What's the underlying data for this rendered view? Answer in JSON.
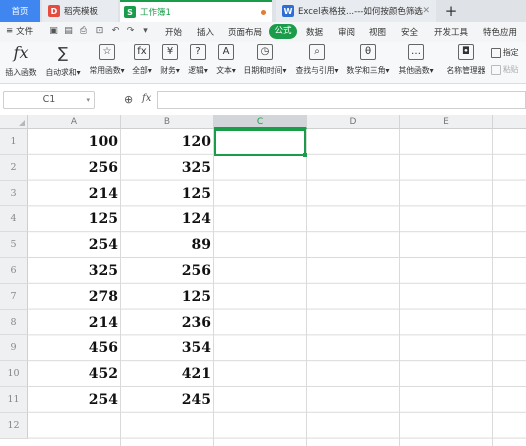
{
  "tabs": {
    "home": "首页",
    "template": "稻壳模板",
    "workbook": "工作簿1",
    "excel": "Excel表格技...---如何按颜色筛选"
  },
  "menu": {
    "file": "文件",
    "items": [
      "开始",
      "插入",
      "页面布局",
      "公式",
      "数据",
      "审阅",
      "视图",
      "安全",
      "开发工具",
      "特色应用"
    ],
    "active": "公式"
  },
  "ribbon": {
    "insert_function": "插入函数",
    "autosum": "自动求和",
    "common": "常用函数",
    "all": "全部",
    "finance": "财务",
    "logic": "逻辑",
    "text": "文本",
    "datetime": "日期和时间",
    "lookup": "查找与引用",
    "math": "数学和三角",
    "other": "其他函数",
    "name_manager": "名称管理器",
    "specify": "指定",
    "paste": "粘贴"
  },
  "formula_bar": {
    "name_box": "C1",
    "fx": "fx",
    "value": ""
  },
  "columns": [
    "A",
    "B",
    "C",
    "D",
    "E"
  ],
  "active_column": "C",
  "rows": [
    "1",
    "2",
    "3",
    "4",
    "5",
    "6",
    "7",
    "8",
    "9",
    "10",
    "11",
    "12"
  ],
  "sheet": [
    {
      "a": "100",
      "b": "120"
    },
    {
      "a": "256",
      "b": "325"
    },
    {
      "a": "214",
      "b": "125"
    },
    {
      "a": "125",
      "b": "124"
    },
    {
      "a": "254",
      "b": "89"
    },
    {
      "a": "325",
      "b": "256"
    },
    {
      "a": "278",
      "b": "125"
    },
    {
      "a": "214",
      "b": "236"
    },
    {
      "a": "456",
      "b": "354"
    },
    {
      "a": "452",
      "b": "421"
    },
    {
      "a": "254",
      "b": "245"
    }
  ],
  "colors": {
    "accent": "#1a9c4a",
    "home_tab": "#3f86f0"
  }
}
